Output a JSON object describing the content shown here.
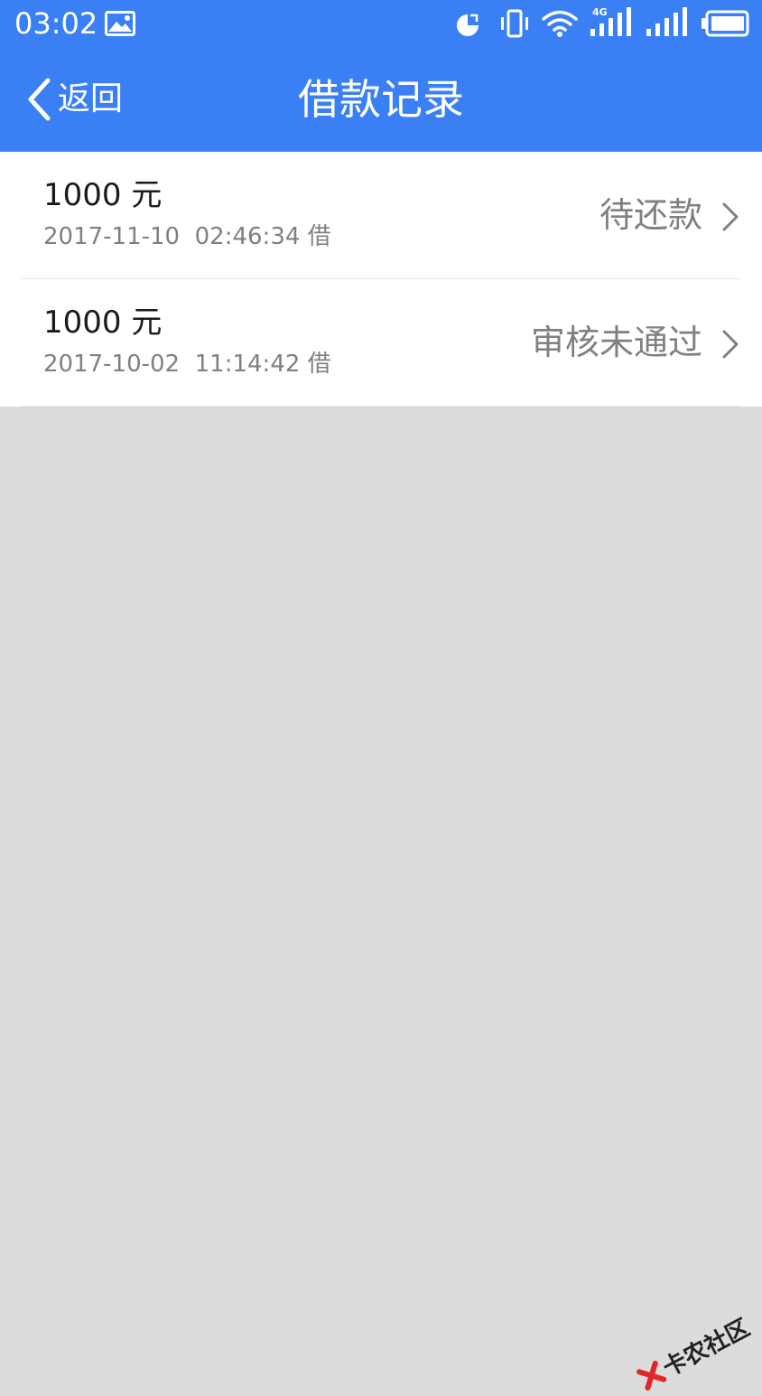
{
  "status_bar": {
    "time": "03:02",
    "network_label": "4G",
    "icons": [
      "gallery-notification-icon",
      "data-saver-icon",
      "vibrate-icon",
      "wifi-icon",
      "signal-4g-icon",
      "signal-icon",
      "battery-icon"
    ]
  },
  "nav": {
    "back_label": "返回",
    "title": "借款记录"
  },
  "records": [
    {
      "amount": "1000 元",
      "timestamp": "2017-11-10  02:46:34 借",
      "status": "待还款"
    },
    {
      "amount": "1000 元",
      "timestamp": "2017-10-02  11:14:42 借",
      "status": "审核未通过"
    }
  ],
  "watermark": {
    "text": "卡农社区"
  },
  "colors": {
    "header_blue": "#3a80f4",
    "page_background": "#dcdcdc",
    "list_background": "#ffffff",
    "secondary_text": "#808080"
  }
}
